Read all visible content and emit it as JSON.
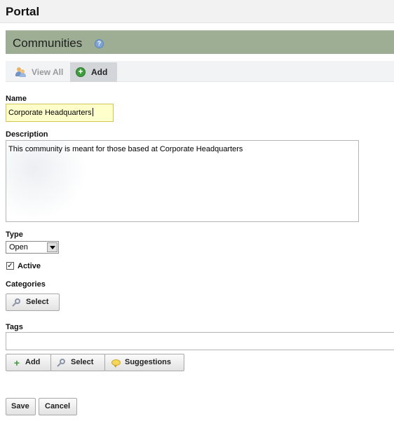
{
  "header": {
    "title": "Portal"
  },
  "portlet": {
    "title": "Communities",
    "help_icon": "?"
  },
  "tabs": [
    {
      "label": "View All",
      "icon": "people-icon",
      "active": false
    },
    {
      "label": "Add",
      "icon": "add-icon",
      "active": true
    }
  ],
  "form": {
    "name_label": "Name",
    "name_value": "Corporate Headquarters",
    "description_label": "Description",
    "description_value": "This community is meant for those based at Corporate Headquarters",
    "type_label": "Type",
    "type_value": "Open",
    "active_label": "Active",
    "active_checked": true,
    "active_check_glyph": "✓",
    "categories_label": "Categories",
    "categories_select": "Select",
    "tags_label": "Tags",
    "tags_value": "",
    "tags_add": "Add",
    "tags_select": "Select",
    "tags_suggestions": "Suggestions",
    "save": "Save",
    "cancel": "Cancel"
  },
  "colors": {
    "portlet_header": "#9eae95",
    "name_field_bg": "#ffffcc",
    "active_tab_bg": "#d3d6d9"
  }
}
